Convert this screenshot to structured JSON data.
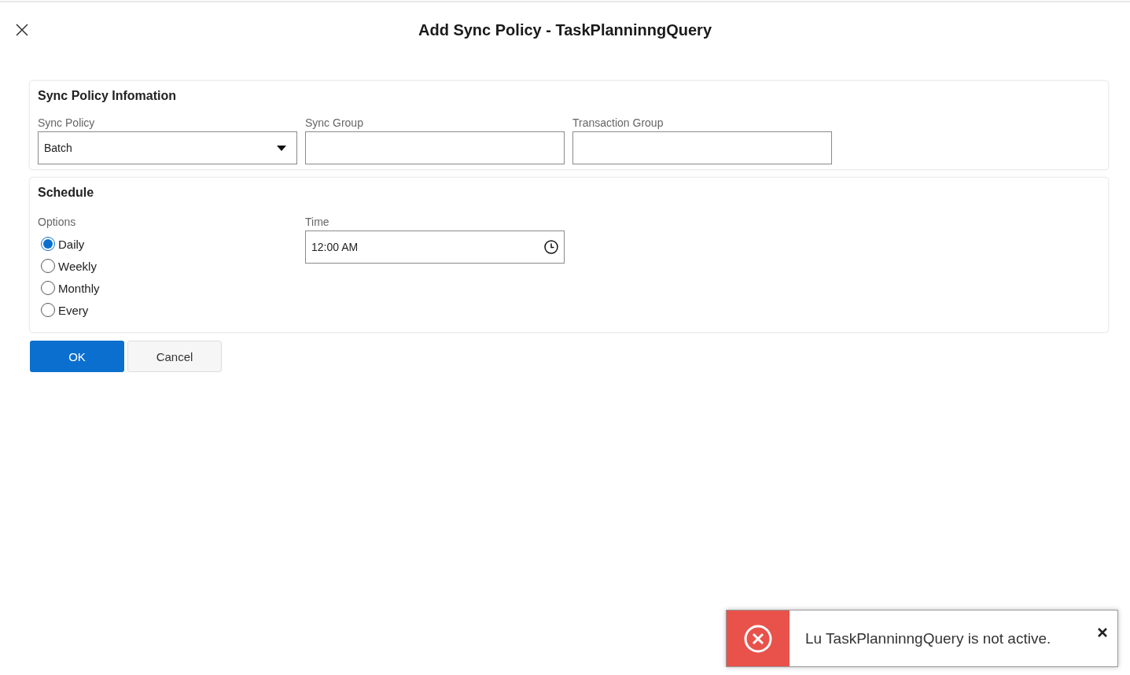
{
  "dialog": {
    "title": "Add Sync Policy - TaskPlanninngQuery"
  },
  "info_section": {
    "heading": "Sync Policy Infomation",
    "fields": [
      {
        "kind": "dropdown",
        "label": "Sync Policy",
        "value": "Batch"
      },
      {
        "kind": "text",
        "label": "Sync Group"
      },
      {
        "kind": "text",
        "label": "Transaction Group"
      }
    ]
  },
  "schedule_section": {
    "heading": "Schedule",
    "options_label": "Options",
    "options": [
      {
        "label": "Daily",
        "selected": true
      },
      {
        "label": "Weekly",
        "selected": false
      },
      {
        "label": "Monthly",
        "selected": false
      },
      {
        "label": "Every",
        "selected": false
      }
    ],
    "time": {
      "label": "Time",
      "value": "12:00 AM"
    }
  },
  "buttons": [
    {
      "label": "OK",
      "kind": "primary"
    },
    {
      "label": "Cancel",
      "kind": "secondary"
    }
  ],
  "toast": {
    "kind": "error",
    "message": "Lu TaskPlanninngQuery is not active."
  }
}
